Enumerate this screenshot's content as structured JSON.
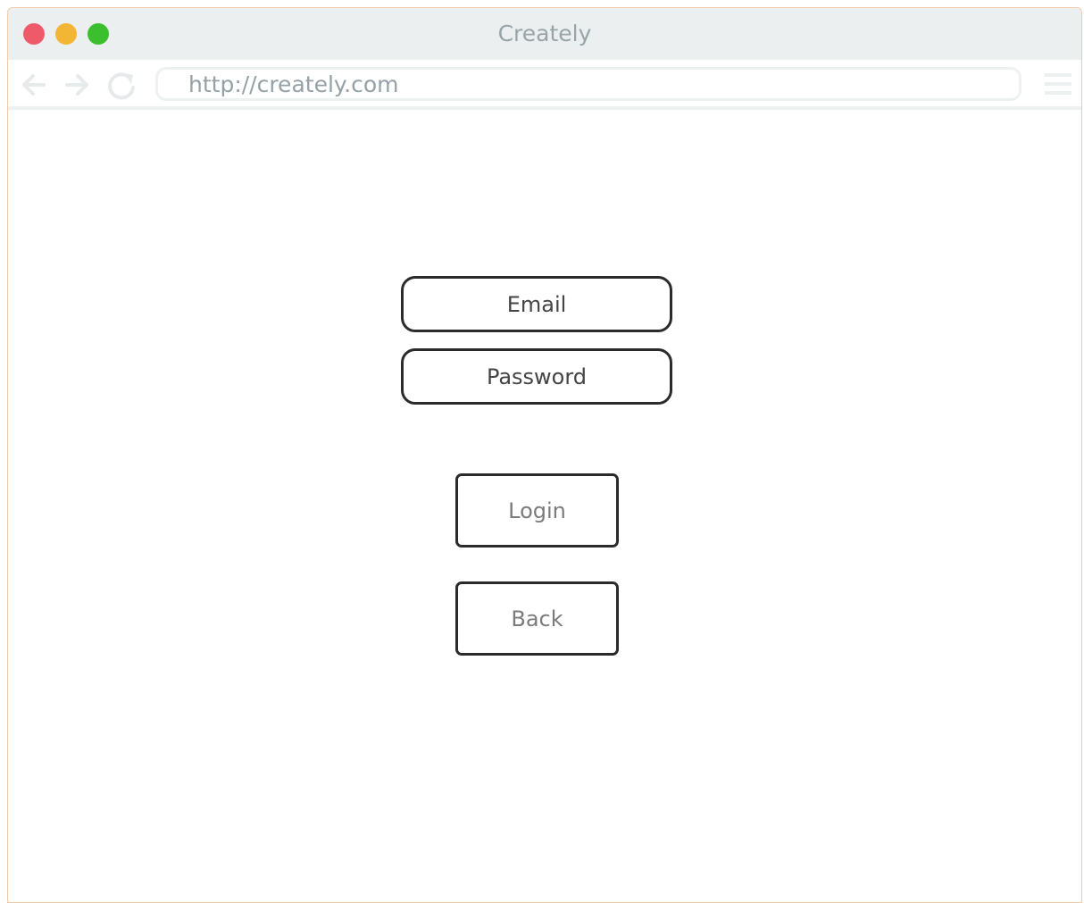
{
  "window": {
    "title": "Creately"
  },
  "navbar": {
    "url": "http://creately.com",
    "icons": [
      "back-arrow-icon",
      "forward-arrow-icon",
      "reload-icon",
      "hamburger-menu-icon"
    ]
  },
  "form": {
    "email_label": "Email",
    "password_label": "Password",
    "login_label": "Login",
    "back_label": "Back"
  },
  "colors": {
    "close": "#ee5a6a",
    "minimize": "#f2b534",
    "maximize": "#3cbf2e",
    "titlebar": "#eceff0",
    "border": "#2b2b2b"
  }
}
